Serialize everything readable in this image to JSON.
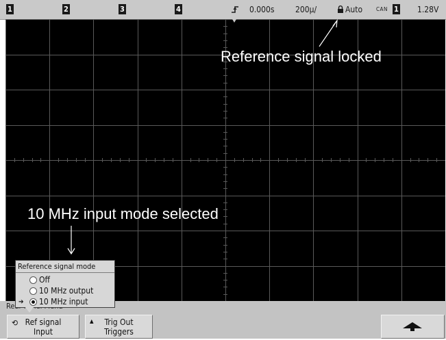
{
  "status_bar": {
    "channels": [
      "1",
      "2",
      "3",
      "4"
    ],
    "time_delay": "0.000s",
    "time_per_div": "200µ/",
    "trigger_mode": "Auto",
    "trigger_type": "CAN",
    "trigger_source": "1",
    "trigger_level": "1.28V"
  },
  "annotations": {
    "reference_locked": "Reference signal locked",
    "input_mode_selected": "10 MHz input mode selected"
  },
  "popup": {
    "title": "Reference signal mode",
    "options": [
      {
        "label": "Off",
        "selected": false
      },
      {
        "label": "10 MHz output",
        "selected": false
      },
      {
        "label": "10 MHz input",
        "selected": true
      }
    ]
  },
  "softkeys": {
    "menu_title": "Rear Panel Menu",
    "ref_signal": {
      "line1": "Ref signal",
      "line2": "Input"
    },
    "trig_out": {
      "line1": "Trig Out",
      "line2": "Triggers"
    },
    "back_icon": "up-arrow-icon"
  },
  "colors": {
    "display_bg": "#000000",
    "grid": "#5a5a5a",
    "status_bg": "#c9c9c9",
    "softkey_bg": "#d9d9d9"
  }
}
